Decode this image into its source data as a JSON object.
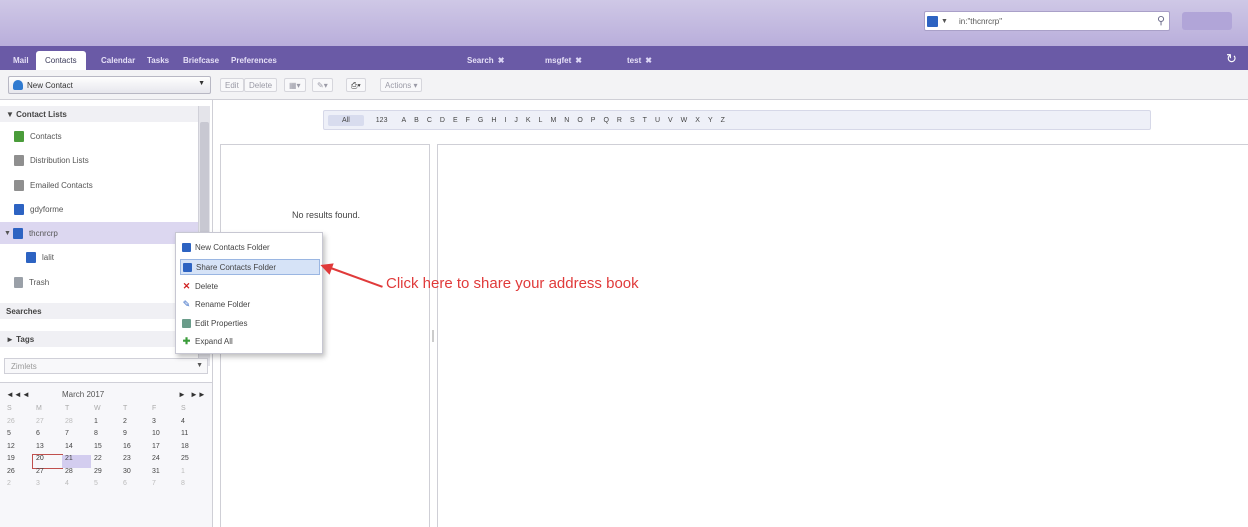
{
  "header": {
    "search_value": "in:\"thcnrcrp\"",
    "colors": {
      "header_bg": "#b9aedb",
      "tabbar_bg": "#6a5aa6"
    }
  },
  "app_tabs": [
    {
      "label": "Mail",
      "active": false
    },
    {
      "label": "Contacts",
      "active": true
    },
    {
      "label": "Calendar",
      "active": false
    },
    {
      "label": "Tasks",
      "active": false
    },
    {
      "label": "Briefcase",
      "active": false
    },
    {
      "label": "Preferences",
      "active": false
    },
    {
      "label": "Search",
      "active": false,
      "closable": true
    },
    {
      "label": "msgfet",
      "active": false,
      "closable": true
    },
    {
      "label": "test",
      "active": false,
      "closable": true
    }
  ],
  "toolbar": {
    "new_contact_label": "New Contact",
    "edit_label": "Edit",
    "delete_label": "Delete",
    "actions_label": "Actions"
  },
  "sidebar": {
    "contact_lists_header": "Contact Lists",
    "items": [
      {
        "label": "Contacts",
        "icon": "green-book-icon"
      },
      {
        "label": "Distribution Lists",
        "icon": "gray-book-icon"
      },
      {
        "label": "Emailed Contacts",
        "icon": "gray-book-icon"
      },
      {
        "label": "gdyforme",
        "icon": "blue-book-icon"
      },
      {
        "label": "thcnrcrp",
        "icon": "blue-book-icon",
        "selected": true
      },
      {
        "label": "lalit",
        "icon": "blue-book-icon"
      },
      {
        "label": "Trash",
        "icon": "trash-icon"
      }
    ],
    "searches_header": "Searches",
    "tags_header": "Tags",
    "zimlet_value": "Zimlets"
  },
  "calendar": {
    "month": "March 2017",
    "day_headers": [
      "S",
      "M",
      "T",
      "W",
      "T",
      "F",
      "S"
    ],
    "weeks": [
      [
        "26",
        "27",
        "28",
        "1",
        "2",
        "3",
        "4"
      ],
      [
        "5",
        "6",
        "7",
        "8",
        "9",
        "10",
        "11"
      ],
      [
        "12",
        "13",
        "14",
        "15",
        "16",
        "17",
        "18"
      ],
      [
        "19",
        "20",
        "21",
        "22",
        "23",
        "24",
        "25"
      ],
      [
        "26",
        "27",
        "28",
        "29",
        "30",
        "31",
        "1"
      ],
      [
        "2",
        "3",
        "4",
        "5",
        "6",
        "7",
        "8"
      ]
    ],
    "today": "20",
    "selected": "21"
  },
  "alphabet": [
    "All",
    "123",
    "A",
    "B",
    "C",
    "D",
    "E",
    "F",
    "G",
    "H",
    "I",
    "J",
    "K",
    "L",
    "M",
    "N",
    "O",
    "P",
    "Q",
    "R",
    "S",
    "T",
    "U",
    "V",
    "W",
    "X",
    "Y",
    "Z"
  ],
  "list": {
    "empty_text": "No results found."
  },
  "context_menu": {
    "items": [
      {
        "label": "New Contacts Folder",
        "icon": "new-folder-icon"
      },
      {
        "label": "Share Contacts Folder",
        "icon": "share-folder-icon",
        "highlighted": true
      },
      {
        "label": "Delete",
        "icon": "delete-x-icon"
      },
      {
        "label": "Rename Folder",
        "icon": "rename-icon"
      },
      {
        "label": "Edit Properties",
        "icon": "properties-icon"
      },
      {
        "label": "Expand All",
        "icon": "expand-all-icon"
      }
    ]
  },
  "annotation": {
    "text": "Click here to share your address book",
    "color": "#e03a3a"
  }
}
